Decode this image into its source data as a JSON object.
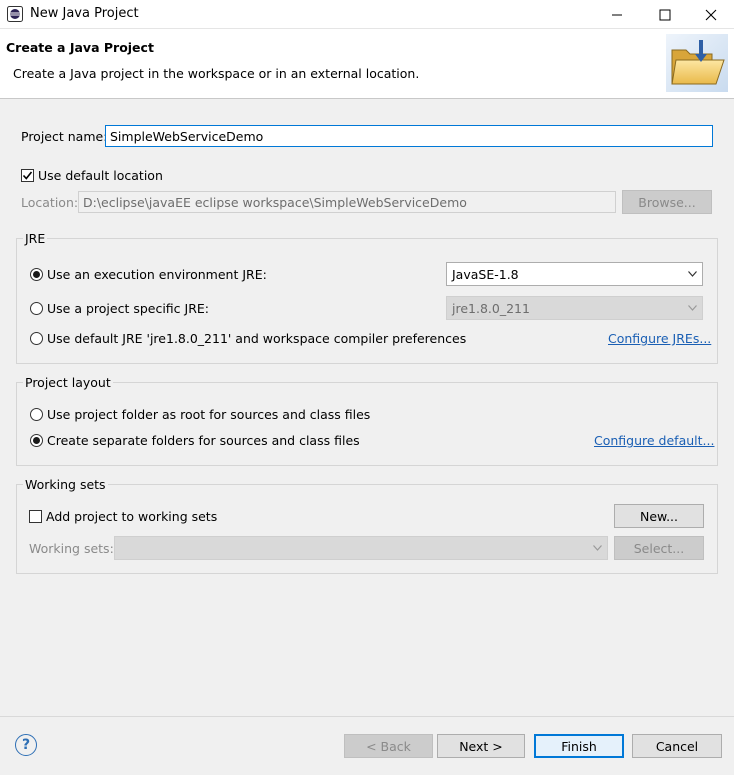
{
  "window": {
    "title": "New Java Project",
    "minimize_icon": "minimize-icon",
    "maximize_icon": "maximize-icon",
    "close_icon": "close-icon"
  },
  "banner": {
    "title": "Create a Java Project",
    "description": "Create a Java project in the workspace or in an external location.",
    "icon": "folder-icon"
  },
  "project": {
    "name_label": "Project name:",
    "name_value": "SimpleWebServiceDemo",
    "use_default_location_label": "Use default location",
    "use_default_location_checked": true,
    "location_label": "Location:",
    "location_value": "D:\\eclipse\\javaEE eclipse workspace\\SimpleWebServiceDemo",
    "browse_label": "Browse..."
  },
  "jre": {
    "group_title": "JRE",
    "options": [
      {
        "label": "Use an execution environment JRE:",
        "selected": true
      },
      {
        "label": "Use a project specific JRE:",
        "selected": false
      },
      {
        "label": "Use default JRE 'jre1.8.0_211' and workspace compiler preferences",
        "selected": false
      }
    ],
    "execution_env_value": "JavaSE-1.8",
    "project_jre_value": "jre1.8.0_211",
    "configure_link": "Configure JREs..."
  },
  "layout": {
    "group_title": "Project layout",
    "options": [
      {
        "label": "Use project folder as root for sources and class files",
        "selected": false
      },
      {
        "label": "Create separate folders for sources and class files",
        "selected": true
      }
    ],
    "configure_link": "Configure default..."
  },
  "working_sets": {
    "group_title": "Working sets",
    "add_label": "Add project to working sets",
    "add_checked": false,
    "new_label": "New...",
    "sets_label": "Working sets:",
    "select_label": "Select..."
  },
  "footer": {
    "help_icon": "help-icon",
    "help_glyph": "?",
    "back_label": "< Back",
    "next_label": "Next >",
    "finish_label": "Finish",
    "cancel_label": "Cancel"
  }
}
